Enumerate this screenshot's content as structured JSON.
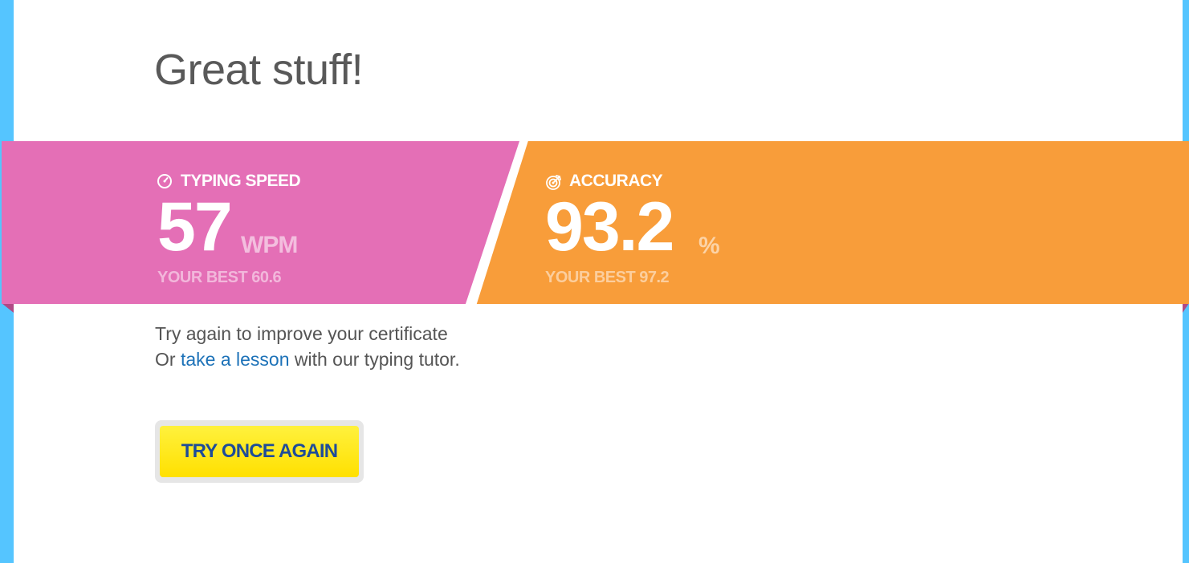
{
  "result": {
    "heading": "Great stuff!"
  },
  "stats": {
    "speed": {
      "label": "TYPING SPEED",
      "icon": "speedometer-icon",
      "value": "57",
      "unit": "WPM",
      "best": "YOUR BEST 60.6",
      "color": "#e46fb6"
    },
    "accuracy": {
      "label": "ACCURACY",
      "icon": "target-icon",
      "value": "93.2",
      "unit": "%",
      "best": "YOUR BEST 97.2",
      "color": "#f89d3a"
    }
  },
  "message": {
    "line1": "Try again to improve your certificate",
    "line2_prefix": "Or ",
    "line2_link": "take a lesson",
    "line2_suffix": " with our typing tutor."
  },
  "actions": {
    "retry_label": "TRY ONCE AGAIN",
    "retry_color": "#ffe000"
  },
  "colors": {
    "background": "#55c5ff",
    "link": "#1d72b8",
    "button_text": "#1e4c99"
  }
}
